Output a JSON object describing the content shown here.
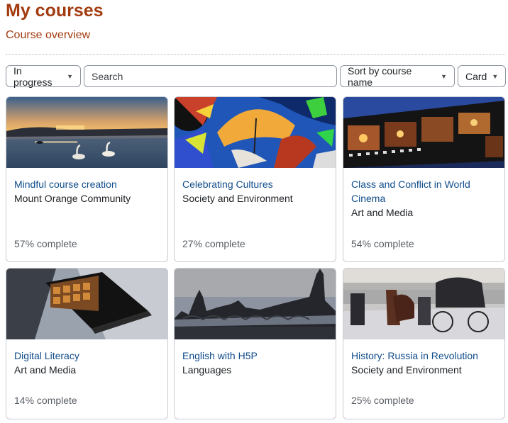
{
  "page": {
    "title": "My courses",
    "section_title": "Course overview"
  },
  "controls": {
    "filter_label": "In progress",
    "search_placeholder": "Search",
    "sort_label": "Sort by course name",
    "view_label": "Card"
  },
  "courses": [
    {
      "name": "Mindful course creation",
      "category": "Mount Orange Community",
      "progress": 57,
      "progress_label": "57% complete",
      "image": "lake-with-swans-at-sunset"
    },
    {
      "name": "Celebrating Cultures",
      "category": "Society and Environment",
      "progress": 27,
      "progress_label": "27% complete",
      "image": "colorful-umbrellas"
    },
    {
      "name": "Class and Conflict in World Cinema",
      "category": "Art and Media",
      "progress": 54,
      "progress_label": "54% complete",
      "image": "film-strip"
    },
    {
      "name": "Digital Literacy",
      "category": "Art and Media",
      "progress": 14,
      "progress_label": "14% complete",
      "image": "tablet-with-bookshelf"
    },
    {
      "name": "English with H5P",
      "category": "Languages",
      "progress": null,
      "progress_label": "",
      "image": "london-skyline"
    },
    {
      "name": "History: Russia in Revolution",
      "category": "Society and Environment",
      "progress": 25,
      "progress_label": "25% complete",
      "image": "horse-carriages-in-snow"
    }
  ]
}
